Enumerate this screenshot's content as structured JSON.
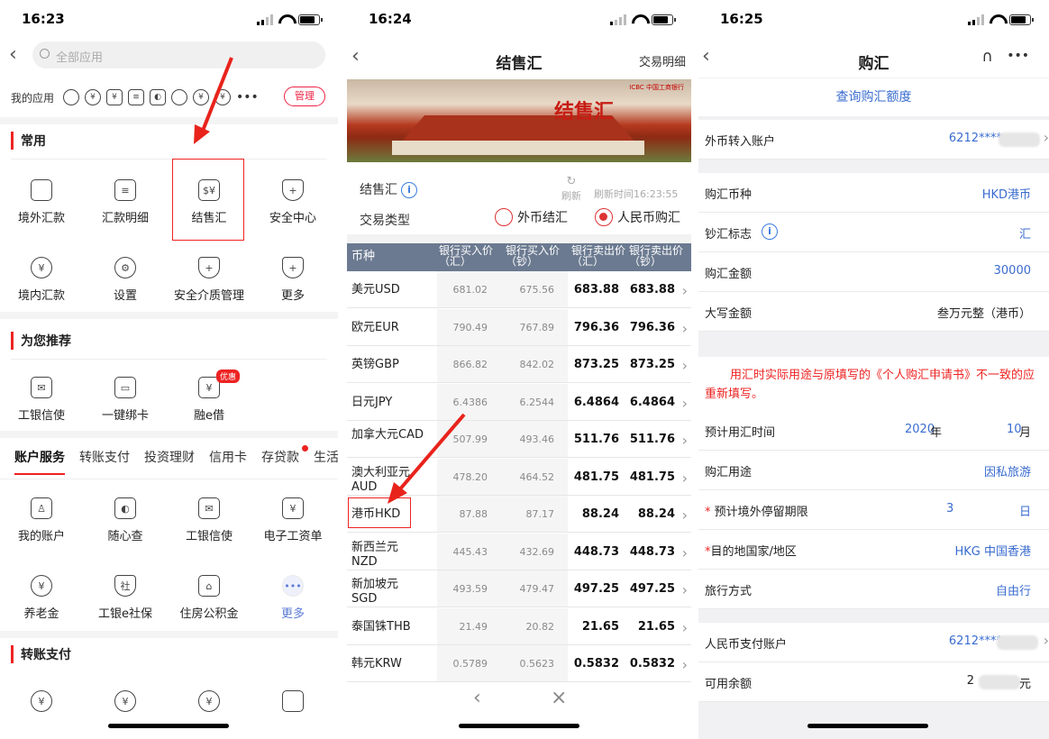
{
  "s1": {
    "time": "16:23",
    "search_placeholder": "全部应用",
    "my_apps_label": "我的应用",
    "manage": "管理",
    "common_title": "常用",
    "common": [
      "境外汇款",
      "汇款明细",
      "结售汇",
      "安全中心",
      "境内汇款",
      "设置",
      "安全介质管理",
      "更多"
    ],
    "recommend_title": "为您推荐",
    "recommend": [
      "工银信使",
      "一键绑卡",
      "融e借"
    ],
    "badge": "优惠",
    "tabs": [
      "账户服务",
      "转账支付",
      "投资理财",
      "信用卡",
      "存贷款",
      "生活"
    ],
    "account": [
      "我的账户",
      "随心查",
      "工银信使",
      "电子工资单",
      "养老金",
      "工银e社保",
      "住房公积金",
      "更多"
    ],
    "transfer_title": "转账支付"
  },
  "s2": {
    "time": "16:24",
    "title": "结售汇",
    "nav_right": "交易明细",
    "banner_text": "结售汇",
    "banner_bank": "ICBC 中国工商银行",
    "label": "结售汇",
    "refresh": "刷新",
    "refresh_time": "刷新时间16:23:55",
    "trade_type": "交易类型",
    "opt1": "外币结汇",
    "opt2": "人民币购汇",
    "headers": {
      "c0": "币种",
      "c1": "银行买入价（汇）",
      "c2": "银行买入价（钞）",
      "c3": "银行卖出价（汇）",
      "c4": "银行卖出价（钞）"
    },
    "rates": [
      {
        "name": "美元USD",
        "v1": "681.02",
        "v2": "675.56",
        "v3": "683.88",
        "v4": "683.88"
      },
      {
        "name": "欧元EUR",
        "v1": "790.49",
        "v2": "767.89",
        "v3": "796.36",
        "v4": "796.36"
      },
      {
        "name": "英镑GBP",
        "v1": "866.82",
        "v2": "842.02",
        "v3": "873.25",
        "v4": "873.25"
      },
      {
        "name": "日元JPY",
        "v1": "6.4386",
        "v2": "6.2544",
        "v3": "6.4864",
        "v4": "6.4864"
      },
      {
        "name": "加拿大元CAD",
        "v1": "507.99",
        "v2": "493.46",
        "v3": "511.76",
        "v4": "511.76"
      },
      {
        "name": "澳大利亚元AUD",
        "v1": "478.20",
        "v2": "464.52",
        "v3": "481.75",
        "v4": "481.75"
      },
      {
        "name": "港币HKD",
        "v1": "87.88",
        "v2": "87.17",
        "v3": "88.24",
        "v4": "88.24"
      },
      {
        "name": "新西兰元NZD",
        "v1": "445.43",
        "v2": "432.69",
        "v3": "448.73",
        "v4": "448.73"
      },
      {
        "name": "新加坡元SGD",
        "v1": "493.59",
        "v2": "479.47",
        "v3": "497.25",
        "v4": "497.25"
      },
      {
        "name": "泰国铢THB",
        "v1": "21.49",
        "v2": "20.82",
        "v3": "21.65",
        "v4": "21.65"
      },
      {
        "name": "韩元KRW",
        "v1": "0.5789",
        "v2": "0.5623",
        "v3": "0.5832",
        "v4": "0.5832"
      }
    ]
  },
  "s3": {
    "time": "16:25",
    "title": "购汇",
    "query_link": "查询购汇额度",
    "in_account_label": "外币转入账户",
    "in_account": "6212****",
    "currency_label": "购汇币种",
    "currency": "HKD港币",
    "flag_label": "钞汇标志",
    "flag": "汇",
    "amount_label": "购汇金额",
    "amount": "30000",
    "cap_label": "大写金额",
    "cap": "叁万元整（港币）",
    "warning": "用汇时实际用途与原填写的《个人购汇申请书》不一致的应重新填写。",
    "time_label": "预计用汇时间",
    "year": "2020",
    "year_unit": "年",
    "month": "10",
    "month_unit": "月",
    "purpose_label": "购汇用途",
    "purpose": "因私旅游",
    "stay_label": "预计境外停留期限",
    "stay": "3",
    "stay_unit": "日",
    "dest_label": "目的地国家/地区",
    "dest": "HKG 中国香港",
    "travel_label": "旅行方式",
    "travel": "自由行",
    "pay_label": "人民币支付账户",
    "pay_account": "6212****",
    "balance_label": "可用余额",
    "balance_prefix": "2",
    "balance_unit": "元"
  }
}
